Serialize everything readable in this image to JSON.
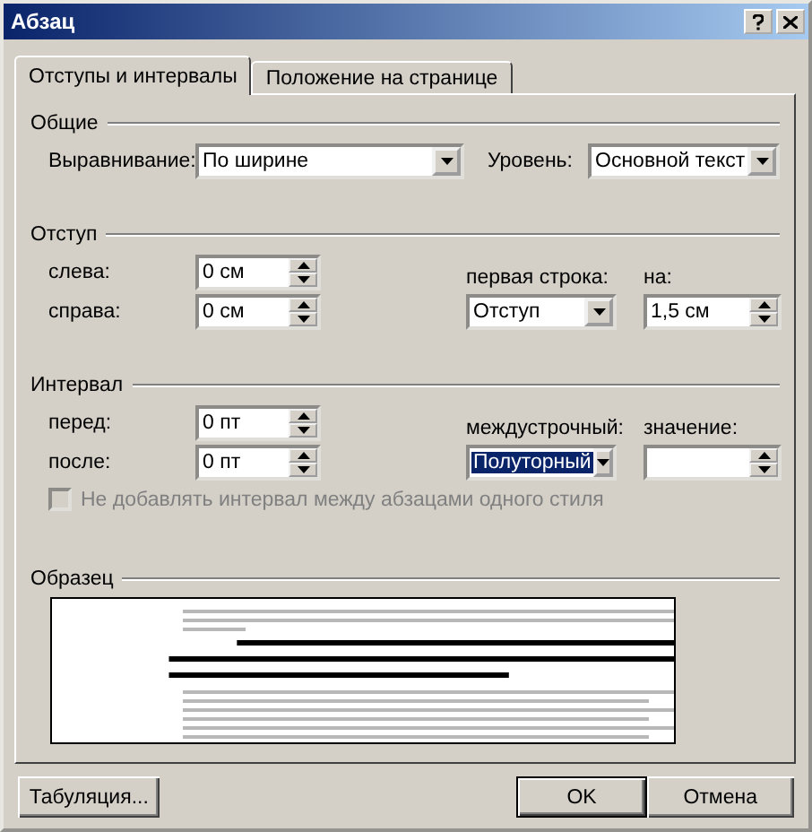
{
  "window": {
    "title": "Абзац"
  },
  "tabs": [
    {
      "label": "Отступы и интервалы",
      "selected": true
    },
    {
      "label": "Положение на странице",
      "selected": false
    }
  ],
  "general": {
    "title": "Общие",
    "alignment": {
      "label": "Выравнивание:",
      "value": "По ширине"
    },
    "level": {
      "label": "Уровень:",
      "value": "Основной текст"
    }
  },
  "indent": {
    "title": "Отступ",
    "left": {
      "label": "слева:",
      "value": "0 см"
    },
    "right": {
      "label": "справа:",
      "value": "0 см"
    },
    "first_line": {
      "label": "первая строка:",
      "value": "Отступ",
      "focused": false
    },
    "by": {
      "label": "на:",
      "value": "1,5 см"
    }
  },
  "spacing": {
    "title": "Интервал",
    "before": {
      "label": "перед:",
      "value": "0 пт"
    },
    "after": {
      "label": "после:",
      "value": "0 пт"
    },
    "line_spacing": {
      "label": "междустрочный:",
      "value": "Полуторный",
      "focused": true
    },
    "at": {
      "label": "значение:"
    },
    "no_space_same_style": {
      "label": "Не добавлять интервал между абзацами одного стиля",
      "checked": false,
      "disabled": true
    }
  },
  "preview": {
    "title": "Образец"
  },
  "buttons": [
    {
      "label": "Табуляция...",
      "default": false
    },
    {
      "label": "OK",
      "default": true
    },
    {
      "label": "Отмена",
      "default": false
    }
  ]
}
